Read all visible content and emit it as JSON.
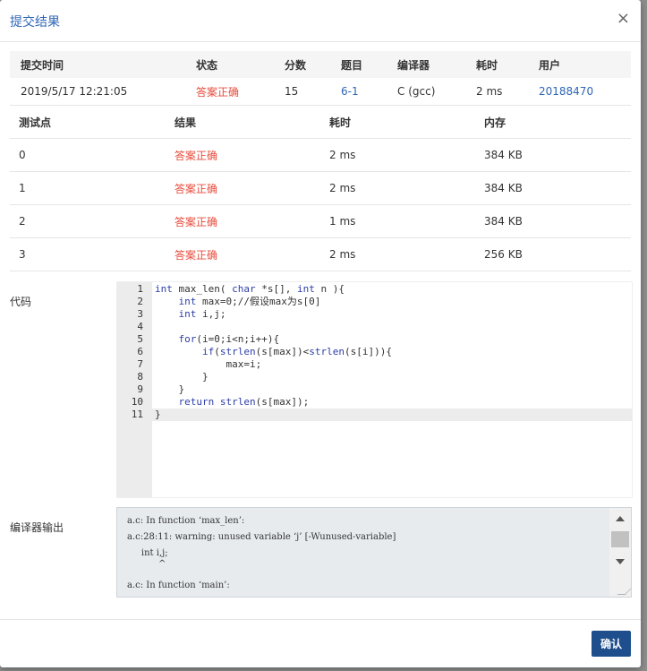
{
  "dialog": {
    "title": "提交结果",
    "close_icon": "×",
    "confirm_label": "确认"
  },
  "submission": {
    "headers": [
      "提交时间",
      "状态",
      "分数",
      "题目",
      "编译器",
      "耗时",
      "用户"
    ],
    "row": {
      "time": "2019/5/17 12:21:05",
      "status": "答案正确",
      "score": "15",
      "problem": "6-1",
      "compiler": "C (gcc)",
      "elapsed": "2 ms",
      "user": "20188470"
    }
  },
  "tests": {
    "headers": [
      "测试点",
      "结果",
      "耗时",
      "内存"
    ],
    "rows": [
      {
        "id": "0",
        "result": "答案正确",
        "time": "2 ms",
        "mem": "384 KB"
      },
      {
        "id": "1",
        "result": "答案正确",
        "time": "2 ms",
        "mem": "384 KB"
      },
      {
        "id": "2",
        "result": "答案正确",
        "time": "1 ms",
        "mem": "384 KB"
      },
      {
        "id": "3",
        "result": "答案正确",
        "time": "2 ms",
        "mem": "256 KB"
      }
    ]
  },
  "code_label": "代码",
  "code_lines": [
    "int max_len( char *s[], int n ){",
    "    int max=0;//假设max为s[0]",
    "    int i,j;",
    "",
    "    for(i=0;i<n;i++){",
    "        if(strlen(s[max])<strlen(s[i])){",
    "            max=i;",
    "        }",
    "    }",
    "    return strlen(s[max]);",
    "}"
  ],
  "compiler_output_label": "编译器输出",
  "compiler_output": [
    "a.c: In function ‘max_len’:",
    "a.c:28:11: warning: unused variable ‘j’ [-Wunused-variable]",
    "     int i,j;",
    "           ^",
    "a.c: In function ‘main’:"
  ],
  "colors": {
    "accent": "#2f66b6",
    "status_ok": "#e74c3c",
    "button": "#1f4e8c"
  }
}
